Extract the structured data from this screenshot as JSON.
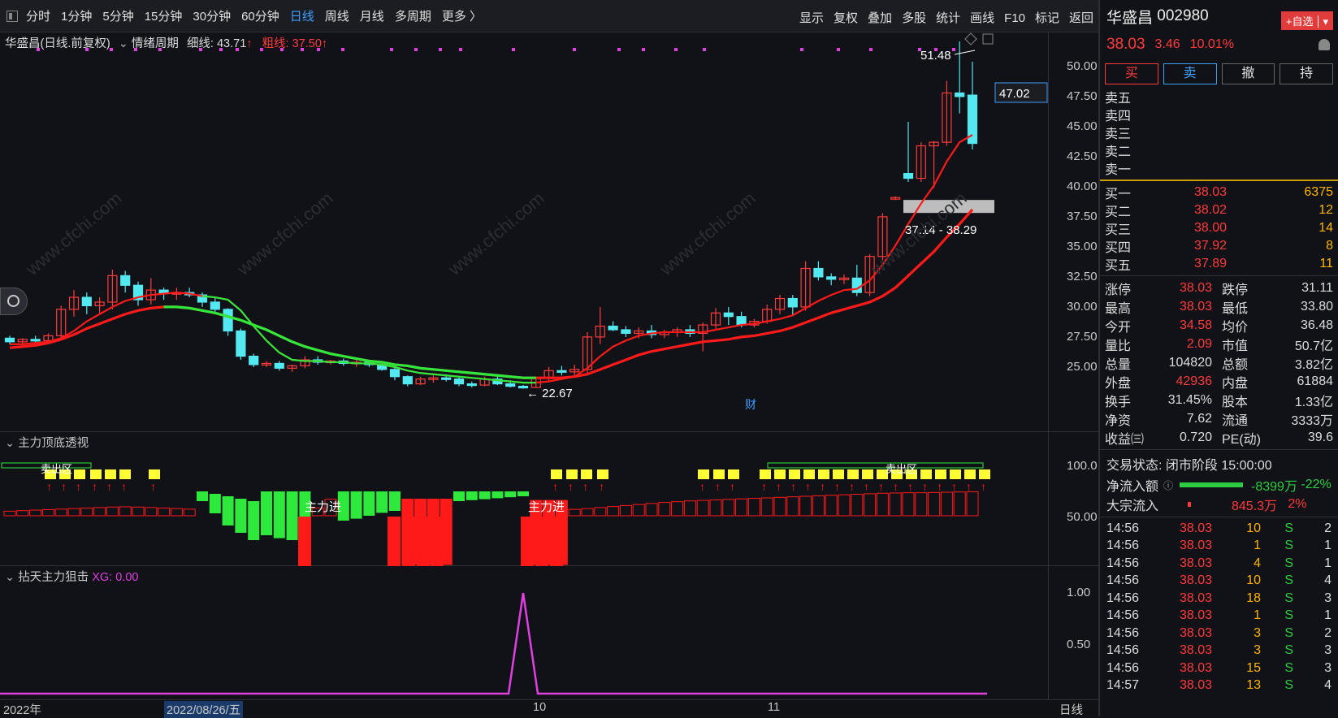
{
  "toolbar": {
    "periods": [
      "分时",
      "1分钟",
      "5分钟",
      "15分钟",
      "30分钟",
      "60分钟",
      "日线",
      "周线",
      "月线",
      "多周期",
      "更多 〉"
    ],
    "active_period": "日线",
    "tools": [
      "显示",
      "复权",
      "叠加",
      "多股",
      "统计",
      "画线",
      "F10",
      "标记",
      "返回"
    ]
  },
  "chart_title": {
    "stock": "华盛昌(日线.前复权)",
    "indicator": "情绪周期",
    "thin": "细线: 43.71",
    "thick": "粗线: 37.50"
  },
  "panel2_title": "主力顶底透视",
  "panel3_title": "拈天主力狙击",
  "panel3_xg": "XG: 0.00",
  "yaxis_main": [
    "50.00",
    "47.50",
    "45.00",
    "42.50",
    "40.00",
    "37.50",
    "35.00",
    "32.50",
    "30.00",
    "27.50",
    "25.00"
  ],
  "yaxis_p2": [
    "100.0",
    "50.00"
  ],
  "yaxis_p3": [
    "1.00",
    "0.50"
  ],
  "x_labels": [
    "2022年",
    "2022/08/26/五",
    "10",
    "11",
    "日线"
  ],
  "annotations": {
    "high": "51.48",
    "low": "22.67",
    "current": "47.02",
    "range": "37.14 - 38.29",
    "cai": "财",
    "buy_in": "主力进",
    "sell_zone": "卖出区"
  },
  "right": {
    "name": "华盛昌",
    "code": "002980",
    "add_btn": "+自选",
    "price": "38.03",
    "change": "3.46",
    "pct": "10.01%",
    "trade_buttons": [
      "买",
      "卖",
      "撤",
      "持"
    ],
    "asks": [
      "卖五",
      "卖四",
      "卖三",
      "卖二",
      "卖一"
    ],
    "bids": [
      {
        "l": "买一",
        "p": "38.03",
        "v": "6375"
      },
      {
        "l": "买二",
        "p": "38.02",
        "v": "12"
      },
      {
        "l": "买三",
        "p": "38.00",
        "v": "14"
      },
      {
        "l": "买四",
        "p": "37.92",
        "v": "8"
      },
      {
        "l": "买五",
        "p": "37.89",
        "v": "11"
      }
    ],
    "stats": [
      {
        "k": "涨停",
        "v": "38.03",
        "vc": "red",
        "k2": "跌停",
        "v2": "31.11",
        "v2c": "green"
      },
      {
        "k": "最高",
        "v": "38.03",
        "vc": "red",
        "k2": "最低",
        "v2": "33.80",
        "v2c": "green"
      },
      {
        "k": "今开",
        "v": "34.58",
        "vc": "red",
        "k2": "均价",
        "v2": "36.48",
        "v2c": "red"
      },
      {
        "k": "量比",
        "v": "2.09",
        "vc": "red",
        "k2": "市值",
        "v2": "50.7亿",
        "v2c": "white"
      },
      {
        "k": "总量",
        "v": "104820",
        "vc": "white",
        "k2": "总额",
        "v2": "3.82亿",
        "v2c": "white"
      },
      {
        "k": "外盘",
        "v": "42936",
        "vc": "red",
        "k2": "内盘",
        "v2": "61884",
        "v2c": "green"
      },
      {
        "k": "换手",
        "v": "31.45%",
        "vc": "white",
        "k2": "股本",
        "v2": "1.33亿",
        "v2c": "white"
      },
      {
        "k": "净资",
        "v": "7.62",
        "vc": "white",
        "k2": "流通",
        "v2": "3333万",
        "v2c": "white"
      },
      {
        "k": "收益㈢",
        "v": "0.720",
        "vc": "white",
        "k2": "PE(动)",
        "v2": "39.6",
        "v2c": "white"
      }
    ],
    "trade_status": "交易状态: 闭市阶段 15:00:00",
    "netflow": {
      "k": "净流入额",
      "v": "-8399万",
      "p": "-22%"
    },
    "block": {
      "k": "大宗流入",
      "v": "845.3万",
      "p": "2%"
    },
    "ticks": [
      {
        "t": "14:56",
        "p": "38.03",
        "v": "10",
        "s": "S",
        "n": "2"
      },
      {
        "t": "14:56",
        "p": "38.03",
        "v": "1",
        "s": "S",
        "n": "1"
      },
      {
        "t": "14:56",
        "p": "38.03",
        "v": "4",
        "s": "S",
        "n": "1"
      },
      {
        "t": "14:56",
        "p": "38.03",
        "v": "10",
        "s": "S",
        "n": "4"
      },
      {
        "t": "14:56",
        "p": "38.03",
        "v": "18",
        "s": "S",
        "n": "3"
      },
      {
        "t": "14:56",
        "p": "38.03",
        "v": "1",
        "s": "S",
        "n": "1"
      },
      {
        "t": "14:56",
        "p": "38.03",
        "v": "3",
        "s": "S",
        "n": "2"
      },
      {
        "t": "14:56",
        "p": "38.03",
        "v": "3",
        "s": "S",
        "n": "3"
      },
      {
        "t": "14:56",
        "p": "38.03",
        "v": "15",
        "s": "S",
        "n": "3"
      },
      {
        "t": "14:57",
        "p": "38.03",
        "v": "13",
        "s": "S",
        "n": "4"
      }
    ]
  },
  "chart_data": {
    "type": "candlestick",
    "candles": [
      [
        26.8,
        27,
        26.3,
        26.5
      ],
      [
        26.5,
        26.8,
        26.2,
        26.7
      ],
      [
        26.7,
        27,
        26.4,
        26.6
      ],
      [
        26.6,
        27.2,
        26.3,
        27.0
      ],
      [
        27,
        29.5,
        26.8,
        29.2
      ],
      [
        29.2,
        30.8,
        28.6,
        30.2
      ],
      [
        30.2,
        30.6,
        28.8,
        29.5
      ],
      [
        29.5,
        30.2,
        28.9,
        29.8
      ],
      [
        29.8,
        32.5,
        29.2,
        32
      ],
      [
        32,
        32.4,
        30.6,
        31.2
      ],
      [
        31.2,
        31.5,
        29.5,
        30
      ],
      [
        30,
        31.8,
        29.6,
        30.8
      ],
      [
        30.8,
        31,
        30,
        30.5
      ],
      [
        30.5,
        31,
        30,
        30.6
      ],
      [
        30.6,
        31,
        30.2,
        30.4
      ],
      [
        30.4,
        30.6,
        29.4,
        29.8
      ],
      [
        29.8,
        30.2,
        28.8,
        29.2
      ],
      [
        29.2,
        29.3,
        27,
        27.4
      ],
      [
        27.4,
        27.6,
        25,
        25.3
      ],
      [
        25.3,
        25.5,
        24.4,
        24.6
      ],
      [
        24.6,
        24.9,
        24.4,
        24.7
      ],
      [
        24.7,
        24.9,
        24.1,
        24.3
      ],
      [
        24.3,
        24.6,
        24,
        24.5
      ],
      [
        24.5,
        25.3,
        24.3,
        25
      ],
      [
        25,
        25.3,
        24.6,
        24.8
      ],
      [
        24.8,
        25,
        24.6,
        24.9
      ],
      [
        24.9,
        25.1,
        24.5,
        24.7
      ],
      [
        24.7,
        25,
        24.4,
        24.8
      ],
      [
        24.8,
        24.9,
        24.4,
        24.6
      ],
      [
        24.6,
        24.7,
        24.1,
        24.2
      ],
      [
        24.2,
        24.4,
        23.3,
        23.6
      ],
      [
        23.6,
        23.7,
        22.8,
        23
      ],
      [
        23,
        23.6,
        22.9,
        23.4
      ],
      [
        23.4,
        23.7,
        23.1,
        23.5
      ],
      [
        23.5,
        23.8,
        23.2,
        23.4
      ],
      [
        23.4,
        23.6,
        22.8,
        23
      ],
      [
        23,
        23.2,
        22.7,
        22.9
      ],
      [
        22.9,
        23.6,
        22.8,
        23.4
      ],
      [
        23.4,
        23.6,
        22.9,
        23
      ],
      [
        23,
        23.3,
        22.7,
        22.8
      ],
      [
        22.8,
        22.9,
        22.6,
        22.7
      ],
      [
        22.7,
        23.6,
        22.67,
        23.5
      ],
      [
        23.5,
        24.4,
        23.2,
        24.1
      ],
      [
        24.1,
        24.5,
        23.7,
        24
      ],
      [
        24,
        24.6,
        23.6,
        24.2
      ],
      [
        24.2,
        27.3,
        23.9,
        26.9
      ],
      [
        26.9,
        29.4,
        26.3,
        27.8
      ],
      [
        27.8,
        28.2,
        27.4,
        27.5
      ],
      [
        27.5,
        27.8,
        26.9,
        27.2
      ],
      [
        27.2,
        27.7,
        26.8,
        27.4
      ],
      [
        27.4,
        27.9,
        26.8,
        27.1
      ],
      [
        27.1,
        27.5,
        26.8,
        27.3
      ],
      [
        27.3,
        27.7,
        26.9,
        27.5
      ],
      [
        27.5,
        27.9,
        26.9,
        27.2
      ],
      [
        27.2,
        28.1,
        25.7,
        27.9
      ],
      [
        27.9,
        29.3,
        27.6,
        28.9
      ],
      [
        28.9,
        29.4,
        27.9,
        28.6
      ],
      [
        28.6,
        29,
        27.7,
        27.9
      ],
      [
        27.9,
        28.4,
        27.7,
        28.2
      ],
      [
        28.2,
        29.6,
        28,
        29.2
      ],
      [
        29.2,
        30.4,
        28.8,
        30.1
      ],
      [
        30.1,
        30.4,
        28.7,
        29.4
      ],
      [
        29.4,
        33.2,
        29.1,
        32.6
      ],
      [
        32.6,
        33.2,
        31.6,
        31.9
      ],
      [
        31.9,
        32.2,
        31.2,
        31.7
      ],
      [
        31.7,
        32.1,
        31.3,
        31.8
      ],
      [
        31.8,
        32.9,
        30.3,
        30.6
      ],
      [
        30.6,
        33.8,
        30.3,
        33.6
      ],
      [
        33.6,
        37.2,
        33.3,
        36.9
      ],
      [
        38.4,
        38.6,
        38.3,
        38.5
      ],
      [
        40.5,
        44.8,
        39.8,
        40.1
      ],
      [
        40.1,
        43.1,
        39.8,
        42.8
      ],
      [
        42.8,
        43.2,
        39.3,
        43.1
      ],
      [
        43.1,
        48.2,
        42.8,
        47.2
      ],
      [
        47.2,
        51.48,
        45.5,
        46.9
      ],
      [
        47.02,
        49.8,
        42.5,
        43
      ]
    ],
    "ma_thin": [
      26.3,
      26.3,
      26.4,
      26.5,
      26.8,
      27.4,
      28.2,
      28.8,
      29.4,
      29.9,
      30.2,
      30.4,
      30.5,
      30.6,
      30.5,
      30.3,
      30.2,
      30,
      29.1,
      27.8,
      26.6,
      25.6,
      25,
      24.9,
      24.9,
      24.8,
      24.8,
      24.7,
      24.7,
      24.6,
      24.4,
      24.1,
      23.9,
      23.8,
      23.7,
      23.6,
      23.5,
      23.4,
      23.3,
      23.2,
      23.1,
      23.1,
      23.2,
      23.4,
      23.6,
      24.3,
      25.3,
      26.1,
      26.6,
      27,
      27.2,
      27.3,
      27.3,
      27.3,
      27.3,
      27.5,
      27.7,
      27.9,
      28,
      28.2,
      28.4,
      28.7,
      29.3,
      29.9,
      30.4,
      30.8,
      30.9,
      31.6,
      32.9,
      34.5,
      36.3,
      38,
      39.5,
      41.5,
      43.1,
      43.71
    ],
    "ma_thick": [
      26,
      26.1,
      26.2,
      26.4,
      26.7,
      27.1,
      27.6,
      28,
      28.4,
      28.8,
      29.1,
      29.3,
      29.4,
      29.4,
      29.3,
      29.1,
      28.9,
      28.6,
      28.3,
      27.9,
      27.5,
      27,
      26.5,
      26.1,
      25.8,
      25.5,
      25.3,
      25.1,
      24.9,
      24.8,
      24.6,
      24.5,
      24.3,
      24.2,
      24.1,
      24,
      23.9,
      23.8,
      23.7,
      23.6,
      23.5,
      23.5,
      23.5,
      23.5,
      23.6,
      23.8,
      24.2,
      24.6,
      25,
      25.4,
      25.7,
      25.9,
      26.1,
      26.3,
      26.5,
      26.6,
      26.7,
      26.9,
      27,
      27.2,
      27.4,
      27.7,
      28.1,
      28.5,
      28.9,
      29.2,
      29.5,
      29.8,
      30.3,
      31,
      32,
      33,
      34,
      35.2,
      36.3,
      37.5
    ],
    "p2_values": [
      18,
      20,
      22,
      24,
      26,
      28,
      30,
      32,
      34,
      35,
      34,
      32,
      30,
      28,
      26,
      -10,
      -20,
      -30,
      -35,
      -40,
      -45,
      -48,
      -50,
      -45,
      30,
      65,
      -30,
      -28,
      -25,
      -22,
      -20,
      65,
      65,
      65,
      65,
      -10,
      -9,
      -8,
      -7,
      -6,
      -5,
      60,
      60,
      60,
      25,
      28,
      32,
      36,
      40,
      44,
      48,
      52,
      55,
      58,
      60,
      62,
      64,
      66,
      68,
      70,
      72,
      74,
      76,
      78,
      80,
      82,
      84,
      86,
      88,
      89,
      90,
      90,
      91,
      92,
      93,
      94
    ],
    "p3_peak_index": 40,
    "ylim_main": [
      22,
      52
    ]
  }
}
